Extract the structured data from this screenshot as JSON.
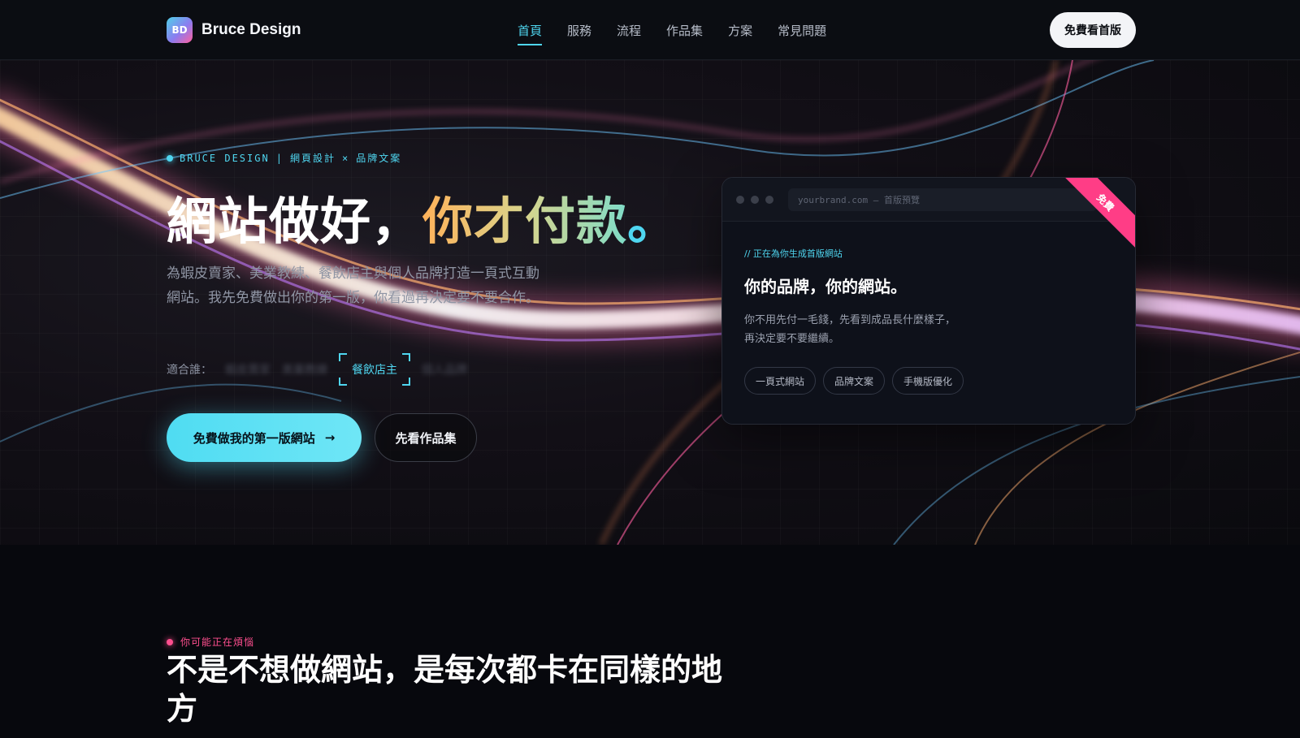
{
  "nav": {
    "logo_text": "BD",
    "brand": "Bruce Design",
    "items": [
      {
        "label": "首頁",
        "active": true
      },
      {
        "label": "服務",
        "active": false
      },
      {
        "label": "流程",
        "active": false
      },
      {
        "label": "作品集",
        "active": false
      },
      {
        "label": "方案",
        "active": false
      },
      {
        "label": "常見問題",
        "active": false
      }
    ],
    "cta": "免費看首版"
  },
  "hero": {
    "eyebrow_brand": "BRUCE DESIGN",
    "eyebrow_sep": "|",
    "eyebrow_service1": "網頁設計",
    "eyebrow_x": "×",
    "eyebrow_service2": "品牌文案",
    "headline_a": "網站做好，",
    "headline_b": "你才付款",
    "headline_c": "。",
    "description": "為蝦皮賣家、美業教練、餐飲店主與個人品牌打造一頁式互動網站。我先免費做出你的第一版，你看過再決定要不要合作。",
    "fit_label": "適合誰：",
    "fit_items": [
      "蝦皮賣家",
      "美業教練",
      "個人品牌"
    ],
    "fit_active": "餐飲店主",
    "primary_button": "免費做我的第一版網站",
    "primary_arrow": "→",
    "secondary_button": "先看作品集"
  },
  "preview_card": {
    "url": "yourbrand.com — 首版預覽",
    "ribbon": "免費",
    "eyebrow": "// 正在為你生成首版網站",
    "title": "你的品牌，你的網站。",
    "text": "你不用先付一毛錢，先看到成品長什麼樣子，再決定要不要繼續。",
    "tags": [
      "一頁式網站",
      "品牌文案",
      "手機版優化"
    ]
  },
  "section2": {
    "eyebrow": "你可能正在煩惱",
    "title": "不是不想做網站，是每次都卡在同樣的地方"
  },
  "colors": {
    "accent": "#4fd6f0",
    "pink": "#ff4f8f",
    "background": "#06070c"
  }
}
